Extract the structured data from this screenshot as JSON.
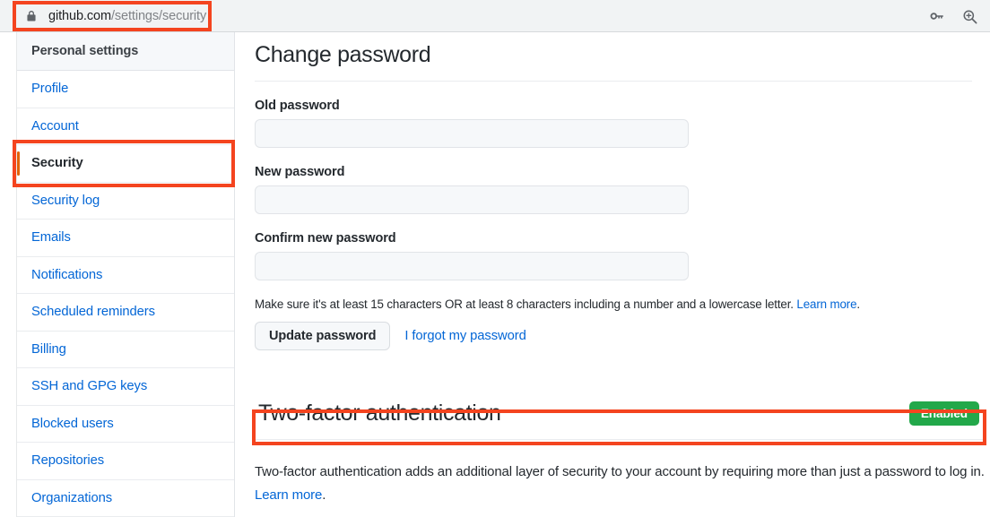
{
  "browser": {
    "url_host": "github.com",
    "url_path": "/settings/security",
    "lock_icon": "lock-icon",
    "actions": [
      {
        "name": "password-key-icon",
        "label": "Saved passwords"
      },
      {
        "name": "zoom-icon",
        "label": "Zoom"
      }
    ]
  },
  "sidebar": {
    "header": "Personal settings",
    "items": [
      {
        "label": "Profile",
        "active": false
      },
      {
        "label": "Account",
        "active": false
      },
      {
        "label": "Security",
        "active": true
      },
      {
        "label": "Security log",
        "active": false
      },
      {
        "label": "Emails",
        "active": false
      },
      {
        "label": "Notifications",
        "active": false
      },
      {
        "label": "Scheduled reminders",
        "active": false
      },
      {
        "label": "Billing",
        "active": false
      },
      {
        "label": "SSH and GPG keys",
        "active": false
      },
      {
        "label": "Blocked users",
        "active": false
      },
      {
        "label": "Repositories",
        "active": false
      },
      {
        "label": "Organizations",
        "active": false
      }
    ]
  },
  "change_password": {
    "title": "Change password",
    "old_password": {
      "label": "Old password",
      "value": "",
      "placeholder": ""
    },
    "new_password": {
      "label": "New password",
      "value": "",
      "placeholder": ""
    },
    "confirm_password": {
      "label": "Confirm new password",
      "value": "",
      "placeholder": ""
    },
    "help_text": "Make sure it's at least 15 characters OR at least 8 characters including a number and a lowercase letter. ",
    "help_link": "Learn more",
    "help_suffix": ".",
    "update_button": "Update password",
    "forgot_link": "I forgot my password"
  },
  "two_factor": {
    "title": "Two-factor authentication",
    "status_badge": "Enabled",
    "description": "Two-factor authentication adds an additional layer of security to your account by requiring more than just a password to log in. ",
    "description_link": "Learn more",
    "description_suffix": "."
  },
  "colors": {
    "link": "#0366d6",
    "annotation": "#f4441f",
    "active_indicator": "#e36209",
    "badge_green": "#22a84a",
    "text": "#24292e"
  }
}
